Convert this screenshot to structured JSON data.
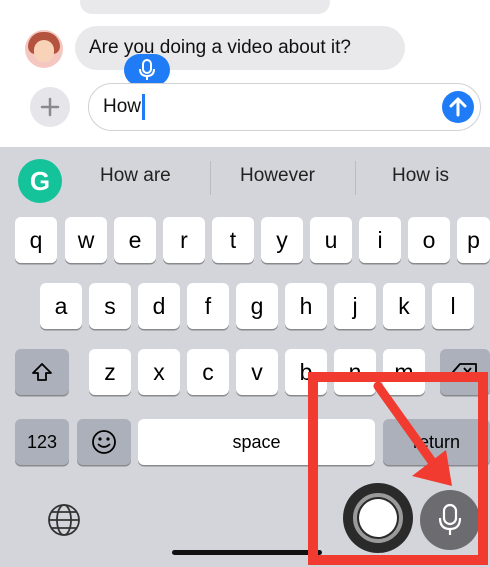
{
  "conversation": {
    "incoming_message": "Are you doing a video about it?"
  },
  "composer": {
    "typed_text": "How",
    "plus_icon": "plus-icon",
    "send_icon": "arrow-up-icon",
    "dictation_icon": "microphone-icon"
  },
  "suggestions": [
    "How are",
    "However",
    "How is"
  ],
  "keyboard": {
    "row1": [
      "q",
      "w",
      "e",
      "r",
      "t",
      "y",
      "u",
      "i",
      "o",
      "p"
    ],
    "row2": [
      "a",
      "s",
      "d",
      "f",
      "g",
      "h",
      "j",
      "k",
      "l"
    ],
    "row3": [
      "z",
      "x",
      "c",
      "v",
      "b",
      "n",
      "m"
    ],
    "numbers_key": "123",
    "space_key": "space",
    "return_key": "return"
  },
  "colors": {
    "accent": "#1f7cf6",
    "annotation": "#f13b30",
    "keyboard_bg": "#d3d5db",
    "grammarly": "#15c39a"
  }
}
